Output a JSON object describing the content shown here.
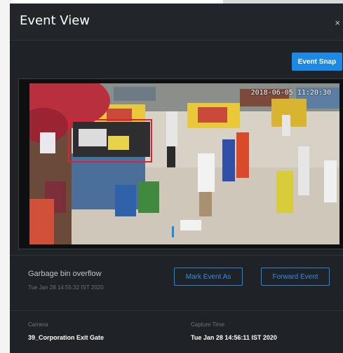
{
  "modal": {
    "title": "Event View",
    "close_label": "×",
    "snap_label": "Event Snap"
  },
  "video": {
    "timestamp": "2018-06-05 11:20:30"
  },
  "event": {
    "name": "Garbage bin overflow",
    "time": "Tue Jan 28 14:55:32 IST 2020",
    "mark_label": "Mark Event As",
    "forward_label": "Forward Event"
  },
  "details": {
    "camera_label": "Camera",
    "camera_value": "39_Corporation Exit Gate",
    "capture_label": "Capture Time",
    "capture_value": "Tue Jan 28 14:56:11 IST 2020"
  },
  "colors": {
    "accent": "#1e88e5",
    "modal_bg": "#1f2328",
    "detection_box": "#e0203a"
  },
  "icons": {
    "close": "close-icon"
  }
}
